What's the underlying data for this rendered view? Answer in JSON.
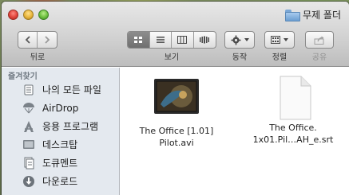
{
  "window": {
    "title": "무제 폴더"
  },
  "toolbar": {
    "back_label": "뒤로",
    "view_label": "보기",
    "action_label": "동작",
    "arrange_label": "정렬",
    "share_label": "공유"
  },
  "sidebar": {
    "heading": "즐겨찾기",
    "items": [
      {
        "label": "나의 모든 파일",
        "icon": "all-my-files-icon"
      },
      {
        "label": "AirDrop",
        "icon": "airdrop-icon"
      },
      {
        "label": "응용 프로그램",
        "icon": "applications-icon"
      },
      {
        "label": "데스크탑",
        "icon": "desktop-icon"
      },
      {
        "label": "도큐멘트",
        "icon": "documents-icon"
      },
      {
        "label": "다운로드",
        "icon": "downloads-icon"
      }
    ]
  },
  "files": [
    {
      "line1": "The Office [1.01]",
      "line2": "Pilot.avi",
      "icon": "video-thumbnail-icon"
    },
    {
      "line1": "The Office.",
      "line2": "1x01.Pil…AH_e.srt",
      "icon": "document-icon"
    }
  ],
  "colors": {
    "sidebar_bg": "#e4e9ef",
    "toolbar_top": "#e8e8e8",
    "toolbar_bottom": "#bdbdbd"
  }
}
